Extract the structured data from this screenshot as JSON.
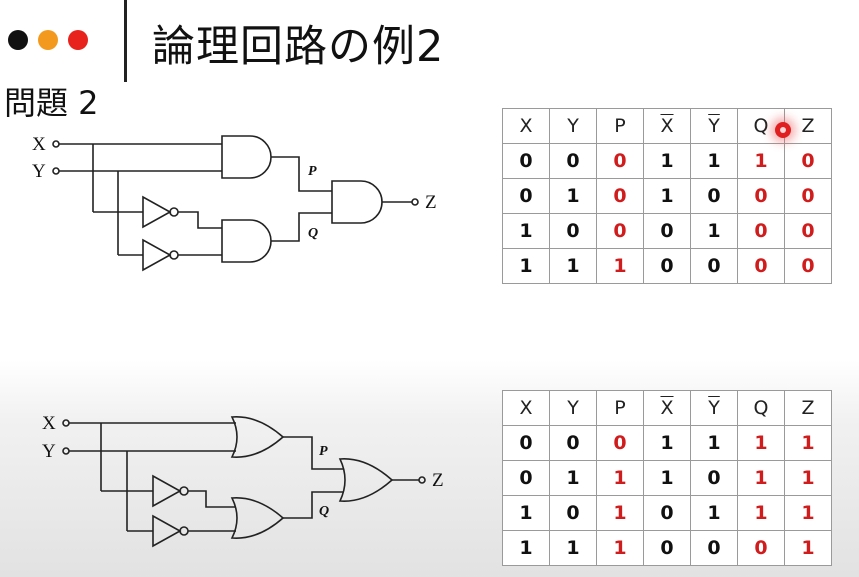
{
  "header": {
    "title": "論理回路の例2",
    "problem_label": "問題 2",
    "dot_colors": [
      "#111111",
      "#f39a1e",
      "#e8231e"
    ]
  },
  "circuits": [
    {
      "input_x": "X",
      "input_y": "Y",
      "wire_p": "P",
      "wire_q": "Q",
      "output": "Z",
      "gate_types": [
        "and-gate",
        "and-gate",
        "and-gate",
        "not-gate",
        "not-gate"
      ]
    },
    {
      "input_x": "X",
      "input_y": "Y",
      "wire_p": "P",
      "wire_q": "Q",
      "output": "Z",
      "gate_types": [
        "or-gate",
        "or-gate",
        "or-gate",
        "not-gate",
        "not-gate"
      ]
    }
  ],
  "tables": [
    {
      "headers": [
        "X",
        "Y",
        "P",
        "X",
        "Y",
        "Q",
        "Z"
      ],
      "overlined_columns": [
        3,
        4
      ],
      "highlight_color": "#d01c1c",
      "rows": [
        {
          "cells": [
            "0",
            "0",
            "0",
            "1",
            "1",
            "1",
            "0"
          ],
          "red": [
            2,
            5,
            6
          ]
        },
        {
          "cells": [
            "0",
            "1",
            "0",
            "1",
            "0",
            "0",
            "0"
          ],
          "red": [
            2,
            5,
            6
          ]
        },
        {
          "cells": [
            "1",
            "0",
            "0",
            "0",
            "1",
            "0",
            "0"
          ],
          "red": [
            2,
            5,
            6
          ]
        },
        {
          "cells": [
            "1",
            "1",
            "1",
            "0",
            "0",
            "0",
            "0"
          ],
          "red": [
            2,
            5,
            6
          ]
        }
      ]
    },
    {
      "headers": [
        "X",
        "Y",
        "P",
        "X",
        "Y",
        "Q",
        "Z"
      ],
      "overlined_columns": [
        3,
        4
      ],
      "highlight_color": "#d01c1c",
      "rows": [
        {
          "cells": [
            "0",
            "0",
            "0",
            "1",
            "1",
            "1",
            "1"
          ],
          "red": [
            2,
            5,
            6
          ]
        },
        {
          "cells": [
            "0",
            "1",
            "1",
            "1",
            "0",
            "1",
            "1"
          ],
          "red": [
            2,
            5,
            6
          ]
        },
        {
          "cells": [
            "1",
            "0",
            "1",
            "0",
            "1",
            "1",
            "1"
          ],
          "red": [
            2,
            5,
            6
          ]
        },
        {
          "cells": [
            "1",
            "1",
            "1",
            "0",
            "0",
            "0",
            "1"
          ],
          "red": [
            2,
            5,
            6
          ]
        }
      ]
    }
  ]
}
